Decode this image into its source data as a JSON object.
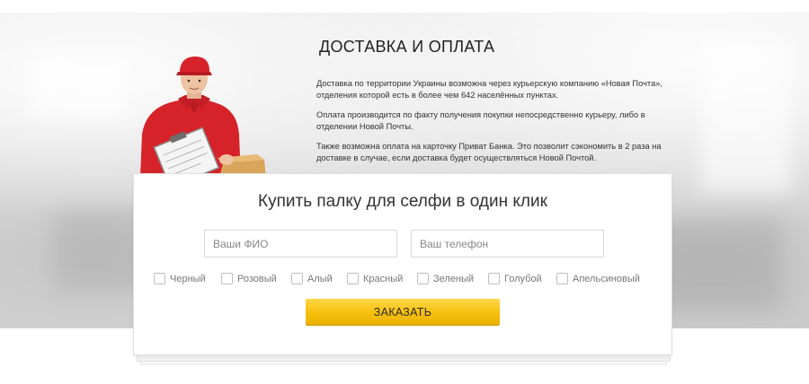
{
  "delivery": {
    "title": "ДОСТАВКА И ОПЛАТА",
    "paragraphs": [
      "Доставка по территории Украины возможна через курьерскую компанию «Новая Почта», отделения которой есть в более чем 642 населённых пунктах.",
      "Оплата производится по факту получения покупки непосредственно курьеру, либо в отделении Новой Почты.",
      "Также возможна оплата на карточку Приват Банка. Это позволит сэкономить в 2 раза на доставке в случае, если доставка будет осуществляться Новой Почтой."
    ]
  },
  "order_form": {
    "title": "Купить палку для селфи в один клик",
    "name_placeholder": "Ваши ФИО",
    "phone_placeholder": "Ваш телефон",
    "colors": [
      "Черный",
      "Розовый",
      "Алый",
      "Красный",
      "Зеленый",
      "Голубой",
      "Апельсиновый"
    ],
    "submit_label": "ЗАКАЗАТЬ"
  },
  "theme": {
    "button_color": "#f6c00c",
    "courier_uniform": "#d6232a"
  }
}
